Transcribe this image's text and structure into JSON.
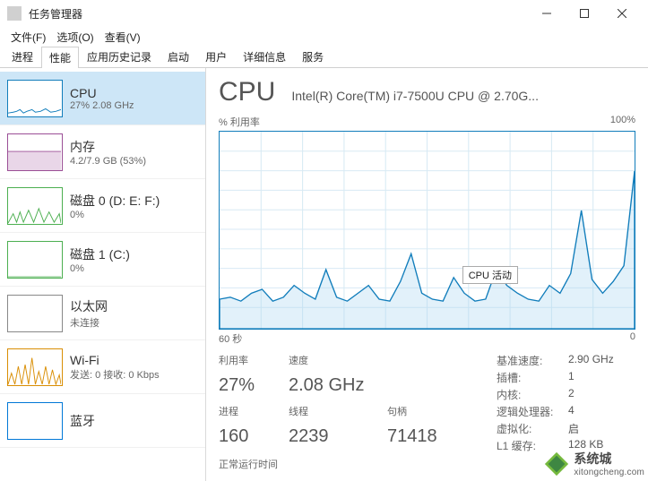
{
  "window": {
    "title": "任务管理器"
  },
  "menu": {
    "file": "文件(F)",
    "options": "选项(O)",
    "view": "查看(V)"
  },
  "tabs": {
    "processes": "进程",
    "performance": "性能",
    "apphistory": "应用历史记录",
    "startup": "启动",
    "users": "用户",
    "details": "详细信息",
    "services": "服务"
  },
  "sidebar": {
    "items": [
      {
        "name": "CPU",
        "sub": "27% 2.08 GHz"
      },
      {
        "name": "内存",
        "sub": "4.2/7.9 GB (53%)"
      },
      {
        "name": "磁盘 0 (D: E: F:)",
        "sub": "0%"
      },
      {
        "name": "磁盘 1 (C:)",
        "sub": "0%"
      },
      {
        "name": "以太网",
        "sub": "未连接"
      },
      {
        "name": "Wi-Fi",
        "sub": "发送: 0 接收: 0 Kbps"
      },
      {
        "name": "蓝牙",
        "sub": ""
      }
    ]
  },
  "main": {
    "title": "CPU",
    "model": "Intel(R) Core(TM) i7-7500U CPU @ 2.70G...",
    "chart_ylabel": "% 利用率",
    "chart_ymax": "100%",
    "chart_x_left": "60 秒",
    "chart_x_right": "0",
    "tooltip": "CPU 活动",
    "stats": {
      "util_label": "利用率",
      "util": "27%",
      "speed_label": "速度",
      "speed": "2.08 GHz",
      "proc_label": "进程",
      "proc": "160",
      "thread_label": "线程",
      "thread": "2239",
      "handle_label": "句柄",
      "handle": "71418",
      "runtime_label": "正常运行时间"
    },
    "right": {
      "base_label": "基准速度:",
      "base": "2.90 GHz",
      "sockets_label": "插槽:",
      "sockets": "1",
      "cores_label": "内核:",
      "cores": "2",
      "lprocs_label": "逻辑处理器:",
      "lprocs": "4",
      "virt_label": "虚拟化:",
      "virt": "启",
      "l1_label": "L1 缓存:",
      "l1": "128 KB"
    }
  },
  "watermark": {
    "brand": "系统城",
    "url": "xitongcheng.com"
  },
  "chart_data": {
    "type": "area",
    "title": "CPU % 利用率",
    "xlabel": "秒",
    "ylabel": "% 利用率",
    "ylim": [
      0,
      100
    ],
    "xrange_seconds": [
      60,
      0
    ],
    "values": [
      15,
      16,
      14,
      18,
      20,
      14,
      16,
      22,
      18,
      15,
      30,
      16,
      14,
      18,
      22,
      15,
      14,
      24,
      38,
      18,
      15,
      14,
      26,
      18,
      14,
      15,
      30,
      22,
      18,
      15,
      14,
      22,
      18,
      28,
      60,
      25,
      18,
      24,
      32,
      80
    ]
  }
}
